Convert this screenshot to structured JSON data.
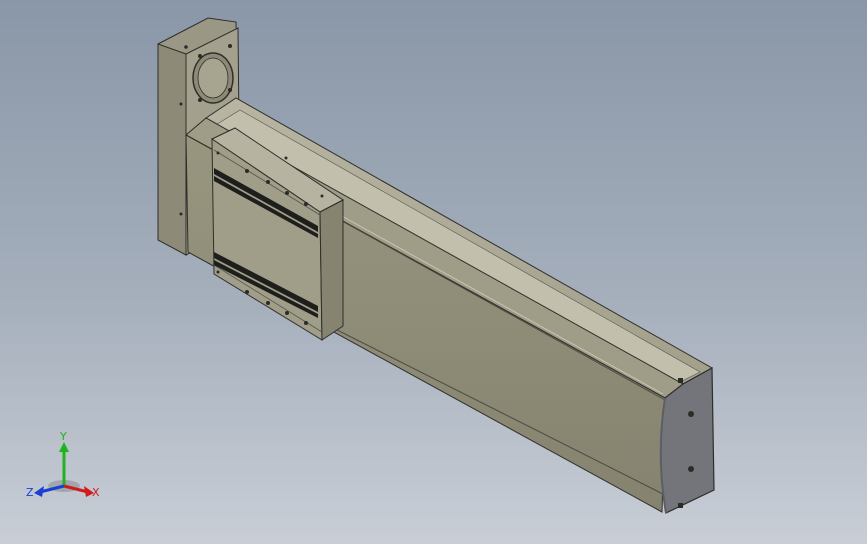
{
  "viewport": {
    "background_top": "#8a97a8",
    "background_bottom": "#c9ced6",
    "model_color": "#8e8c78",
    "model_dark": "#55564c",
    "endcap_color": "#74757a"
  },
  "triad": {
    "x_label": "X",
    "y_label": "Y",
    "z_label": "Z",
    "x_color": "#d11b1b",
    "y_color": "#1fb31f",
    "z_color": "#1b3fd1"
  }
}
